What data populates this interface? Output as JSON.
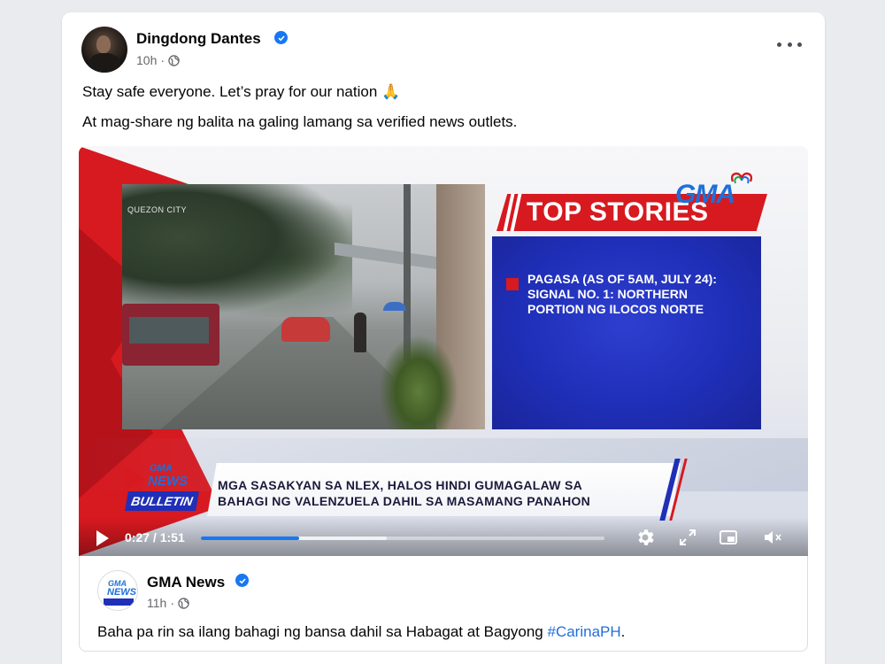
{
  "post": {
    "author": "Dingdong Dantes",
    "time": "10h",
    "dot": "·",
    "line1": "Stay safe everyone. Let’s pray for our nation",
    "line1_emoji": "🙏",
    "line2": "At mag-share ng balita na galing lamang sa verified news outlets."
  },
  "video": {
    "location_tag": "QUEZON CITY",
    "logo": "GMA",
    "top_stories": "TOP STORIES",
    "story": "PAGASA (AS OF 5AM, JULY 24): SIGNAL NO. 1: NORTHERN PORTION NG ILOCOS NORTE",
    "bulletin_logo": {
      "line1": "GMA",
      "line2": "NEWS",
      "line3": "BULLETIN"
    },
    "headline_1": "MGA SASAKYAN SA NLEX, HALOS HINDI GUMAGALAW SA",
    "headline_2": "BAHAGI NG VALENZUELA DAHIL SA MASAMANG PANAHON",
    "elapsed": "0:27",
    "separator": " / ",
    "duration": "1:51",
    "played_fraction": 0.243,
    "buffered_fraction": 0.46,
    "colors": {
      "gma_red": "#d71920",
      "gma_blue": "#1f2fb8",
      "fb_blue": "#1877f2"
    }
  },
  "shared": {
    "author": "GMA News",
    "time": "11h",
    "dot": "·",
    "text_before": "Baha pa rin sa ilang bahagi ng bansa dahil sa Habagat at Bagyong ",
    "hashtag": "#CarinaPH",
    "text_after": ".",
    "avatar_line1": "GMA",
    "avatar_line2": "NEWS"
  }
}
